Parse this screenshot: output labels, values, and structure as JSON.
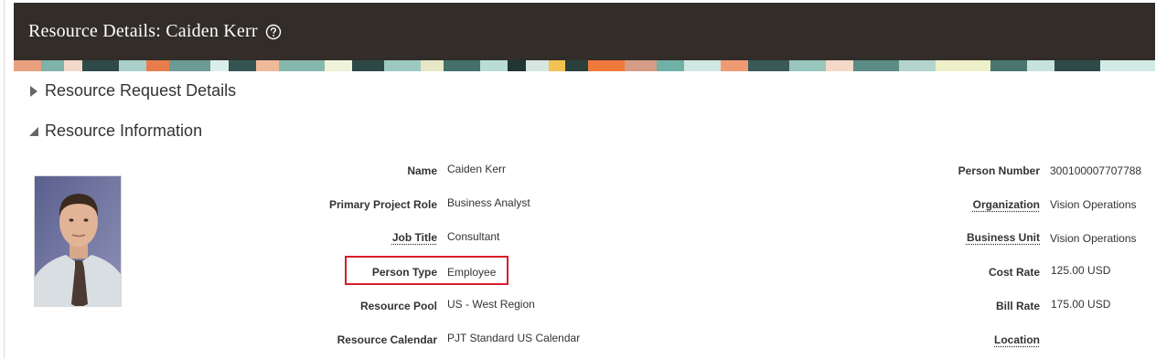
{
  "header": {
    "title": "Resource Details: Caiden Kerr",
    "help_icon": "help-circle-icon"
  },
  "sections": [
    {
      "label": "Resource Request Details",
      "expanded": false
    },
    {
      "label": "Resource Information",
      "expanded": true
    }
  ],
  "left_fields": [
    {
      "label": "Name",
      "value": "Caiden Kerr"
    },
    {
      "label": "Primary Project Role",
      "value": "Business Analyst"
    },
    {
      "label": "Job Title",
      "value": "Consultant"
    },
    {
      "label": "Person Type",
      "value": "Employee"
    },
    {
      "label": "Resource Pool",
      "value": "US - West Region"
    },
    {
      "label": "Resource Calendar",
      "value": "PJT Standard US Calendar"
    }
  ],
  "right_fields": [
    {
      "label": "Person Number",
      "value": "300100007707788"
    },
    {
      "label": "Organization",
      "value": "Vision Operations"
    },
    {
      "label": "Business Unit",
      "value": "Vision Operations"
    },
    {
      "label": "Cost Rate",
      "value": "125.00 USD"
    },
    {
      "label": "Bill Rate",
      "value": "175.00 USD"
    },
    {
      "label": "Location",
      "value": ""
    }
  ],
  "colors": {
    "title_bar": "#322d29",
    "highlight": "#d81e2b"
  }
}
